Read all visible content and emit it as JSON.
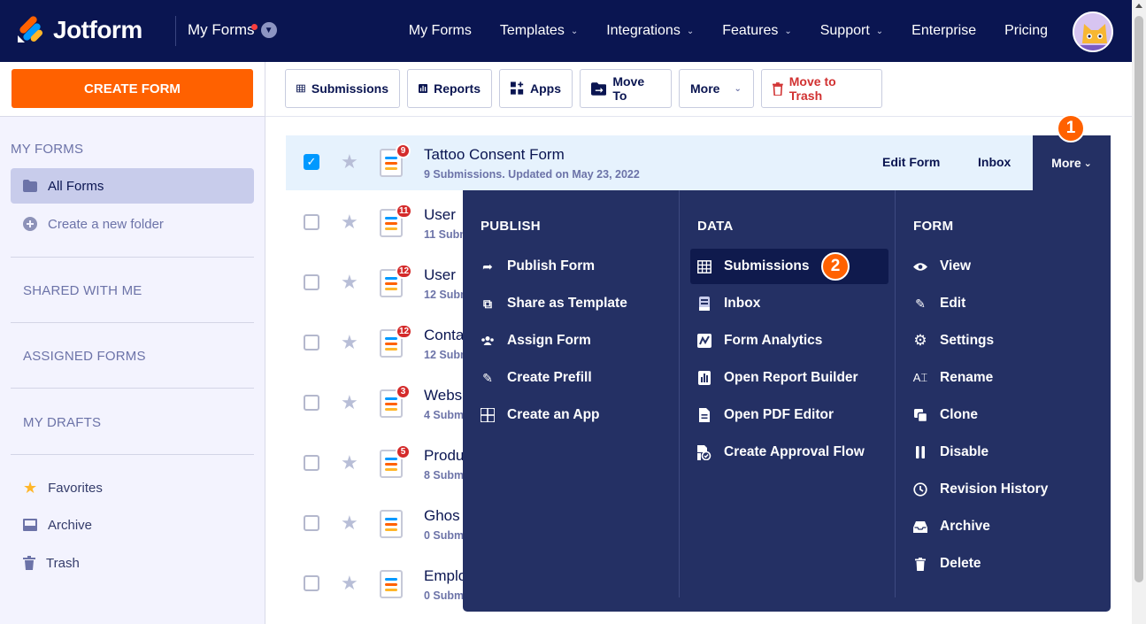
{
  "nav": {
    "brand": "Jotform",
    "myforms_dd": "My Forms",
    "links": [
      "My Forms",
      "Templates",
      "Integrations",
      "Features",
      "Support",
      "Enterprise",
      "Pricing"
    ]
  },
  "sidebar": {
    "create_label": "CREATE FORM",
    "section_myforms": "MY FORMS",
    "all_forms": "All Forms",
    "new_folder": "Create a new folder",
    "shared": "SHARED WITH ME",
    "assigned": "ASSIGNED FORMS",
    "drafts": "MY DRAFTS",
    "favorites": "Favorites",
    "archive": "Archive",
    "trash": "Trash"
  },
  "toolbar": {
    "submissions": "Submissions",
    "reports": "Reports",
    "apps": "Apps",
    "move_to": "Move To",
    "more": "More",
    "move_to_trash": "Move to Trash"
  },
  "forms": [
    {
      "title": "Tattoo Consent Form",
      "sub": "9 Submissions. Updated on May 23, 2022",
      "badge": "9"
    },
    {
      "title": "User",
      "sub": "11 Subm",
      "badge": "11"
    },
    {
      "title": "User",
      "sub": "12 Subm",
      "badge": "12"
    },
    {
      "title": "Conta",
      "sub": "12 Subm",
      "badge": "12"
    },
    {
      "title": "Webs",
      "sub": "4 Subm",
      "badge": "3"
    },
    {
      "title": "Produ",
      "sub": "8 Subm",
      "badge": "5"
    },
    {
      "title": "Ghos",
      "sub": "0 Subm",
      "badge": ""
    },
    {
      "title": "Emplo",
      "sub": "0 Subm",
      "badge": ""
    }
  ],
  "row_actions": {
    "edit": "Edit Form",
    "inbox": "Inbox",
    "more": "More"
  },
  "steps": {
    "one": "1",
    "two": "2"
  },
  "menu": {
    "publish": {
      "heading": "PUBLISH",
      "items": [
        "Publish Form",
        "Share as Template",
        "Assign Form",
        "Create Prefill",
        "Create an App"
      ]
    },
    "data": {
      "heading": "DATA",
      "items": [
        "Submissions",
        "Inbox",
        "Form Analytics",
        "Open Report Builder",
        "Open PDF Editor",
        "Create Approval Flow"
      ]
    },
    "form": {
      "heading": "FORM",
      "items": [
        "View",
        "Edit",
        "Settings",
        "Rename",
        "Clone",
        "Disable",
        "Revision History",
        "Archive",
        "Delete"
      ]
    }
  },
  "colors": {
    "navy": "#0a1551",
    "orange": "#ff6100",
    "menu_bg": "#243064",
    "accent_blue": "#0099ff",
    "trash_red": "#d13131"
  }
}
